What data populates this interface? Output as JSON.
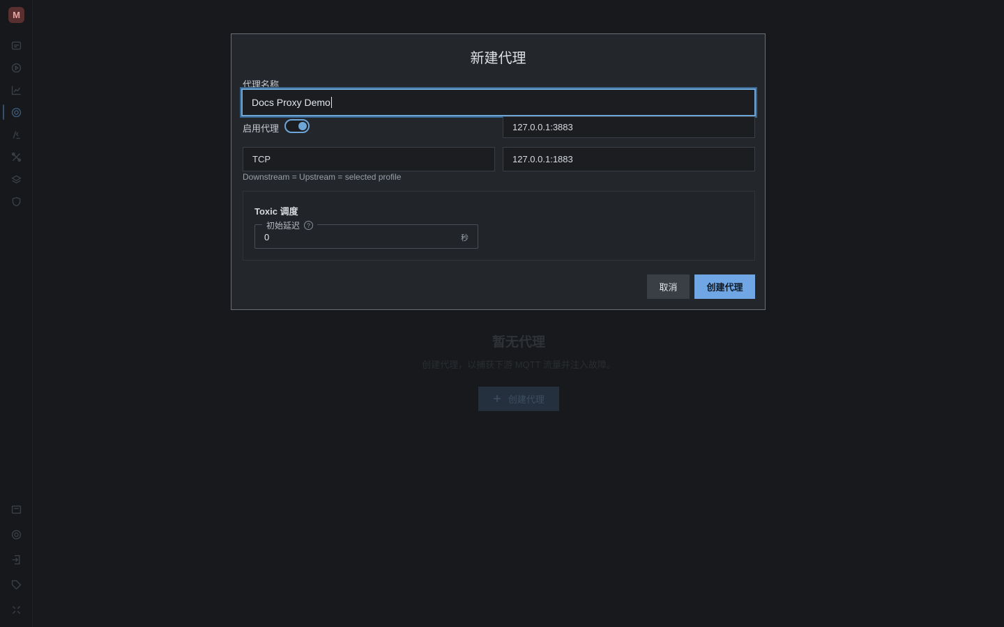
{
  "sidebar": {
    "logo": "M",
    "items": [
      {
        "icon": "connections-icon"
      },
      {
        "icon": "play-icon"
      },
      {
        "icon": "chart-icon"
      },
      {
        "icon": "proxy-icon",
        "active": true
      },
      {
        "icon": "script-icon"
      },
      {
        "icon": "tools-icon"
      },
      {
        "icon": "stack-icon"
      },
      {
        "icon": "shield-icon"
      }
    ],
    "bottom_items": [
      {
        "icon": "log-icon"
      },
      {
        "icon": "settings-icon"
      },
      {
        "icon": "import-icon"
      },
      {
        "icon": "tag-icon"
      },
      {
        "icon": "collapse-icon"
      }
    ]
  },
  "empty_state": {
    "title": "暂无代理",
    "subtitle": "创建代理，以捕获下游 MQTT 流量并注入故障。",
    "button_label": "创建代理",
    "button_icon": "plus-icon"
  },
  "dialog": {
    "title": "新建代理",
    "name_label": "代理名称",
    "name_value": "Docs Proxy Demo",
    "enable_label": "启用代理",
    "enable_value": true,
    "listen_address": "127.0.0.1:3883",
    "protocol": "TCP",
    "upstream_address": "127.0.0.1:1883",
    "helper_text": "Downstream = Upstream = selected profile",
    "toxic": {
      "title": "Toxic 调度",
      "delay_label": "初始延迟",
      "delay_value": "0",
      "delay_unit": "秒"
    },
    "cancel_label": "取消",
    "create_label": "创建代理"
  },
  "colors": {
    "accent": "#6fa6e3",
    "background": "#17191c",
    "dialog_bg": "#23262b"
  }
}
